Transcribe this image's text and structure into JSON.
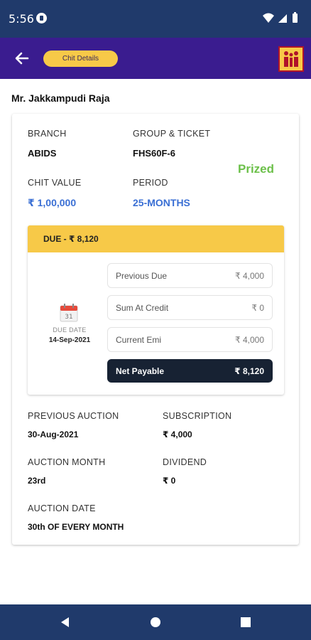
{
  "status_bar": {
    "time": "5:56"
  },
  "app_bar": {
    "pill_label": "Chit Details"
  },
  "customer": {
    "name": "Mr. Jakkampudi Raja"
  },
  "details": {
    "branch_label": "BRANCH",
    "branch_value": "ABIDS",
    "group_label": "GROUP & TICKET",
    "group_value": "FHS60F-6",
    "status_badge": "Prized",
    "chit_value_label": "CHIT VALUE",
    "chit_value": "₹ 1,00,000",
    "period_label": "PERIOD",
    "period_value": "25-MONTHS"
  },
  "due": {
    "header": "DUE -  ₹ 8,120",
    "due_date_label": "DUE DATE",
    "due_date": "14-Sep-2021",
    "rows": [
      {
        "label": "Previous Due",
        "value": "₹ 4,000"
      },
      {
        "label": "Sum At Credit",
        "value": "₹ 0"
      },
      {
        "label": "Current Emi",
        "value": "₹ 4,000"
      },
      {
        "label": "Net Payable",
        "value": "₹ 8,120"
      }
    ]
  },
  "auction": {
    "prev_label": "PREVIOUS AUCTION",
    "prev_value": "30-Aug-2021",
    "subscription_label": "SUBSCRIPTION",
    "subscription_value": "₹ 4,000",
    "month_label": "AUCTION MONTH",
    "month_value": "23rd",
    "dividend_label": "DIVIDEND",
    "dividend_value": "₹ 0",
    "date_label": "AUCTION DATE",
    "date_value": "30th OF EVERY MONTH"
  },
  "colors": {
    "status_bar": "#203a6b",
    "app_bar": "#3a1c8f",
    "accent_yellow": "#f7c948",
    "prized_green": "#6cc04a",
    "value_blue": "#3a6fd4",
    "net_payable_bg": "#172233"
  },
  "icons": {
    "back": "arrow-left-icon",
    "logo": "family-logo-icon",
    "calendar": "calendar-icon",
    "nav_back": "triangle-back-icon",
    "nav_home": "circle-home-icon",
    "nav_recents": "square-recents-icon"
  }
}
